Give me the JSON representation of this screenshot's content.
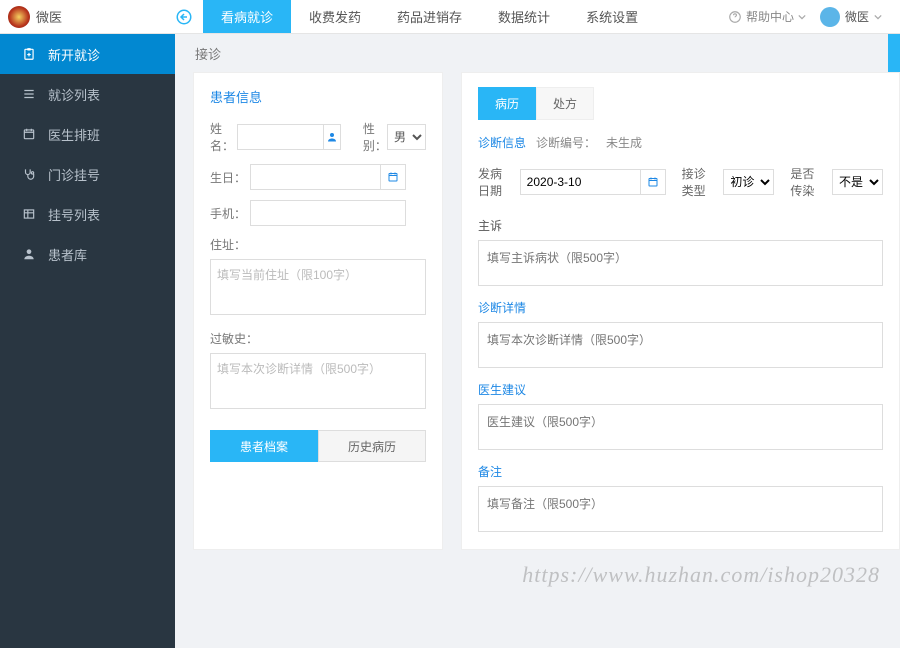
{
  "header": {
    "brand": "微医",
    "nav": [
      "看病就诊",
      "收费发药",
      "药品进销存",
      "数据统计",
      "系统设置"
    ],
    "help": "帮助中心",
    "user": "微医"
  },
  "sidebar": {
    "items": [
      {
        "label": "新开就诊"
      },
      {
        "label": "就诊列表"
      },
      {
        "label": "医生排班"
      },
      {
        "label": "门诊挂号"
      },
      {
        "label": "挂号列表"
      },
      {
        "label": "患者库"
      }
    ]
  },
  "breadcrumb": "接诊",
  "patient": {
    "title": "患者信息",
    "name_label": "姓名：",
    "gender_label": "性别：",
    "gender_value": "男",
    "birthday_label": "生日：",
    "phone_label": "手机：",
    "address_label": "住址：",
    "address_ph": "填写当前住址（限100字）",
    "allergy_label": "过敏史：",
    "allergy_ph": "填写本次诊断详情（限500字）",
    "btn_archive": "患者档案",
    "btn_history": "历史病历"
  },
  "diag": {
    "tab_record": "病历",
    "tab_rx": "处方",
    "info_label": "诊断信息",
    "code_label": "诊断编号：",
    "code_value": "未生成",
    "onset_label": "发病日期",
    "onset_value": "2020-3-10",
    "type_label": "接诊类型",
    "type_value": "初诊",
    "infectious_label": "是否传染",
    "infectious_value": "不是",
    "chief_title": "主诉",
    "chief_ph": "填写主诉病状（限500字）",
    "detail_title": "诊断详情",
    "detail_ph": "填写本次诊断详情（限500字）",
    "advice_title": "医生建议",
    "advice_ph": "医生建议（限500字）",
    "note_title": "备注",
    "note_ph": "填写备注（限500字）"
  },
  "watermark": "https://www.huzhan.com/ishop20328"
}
